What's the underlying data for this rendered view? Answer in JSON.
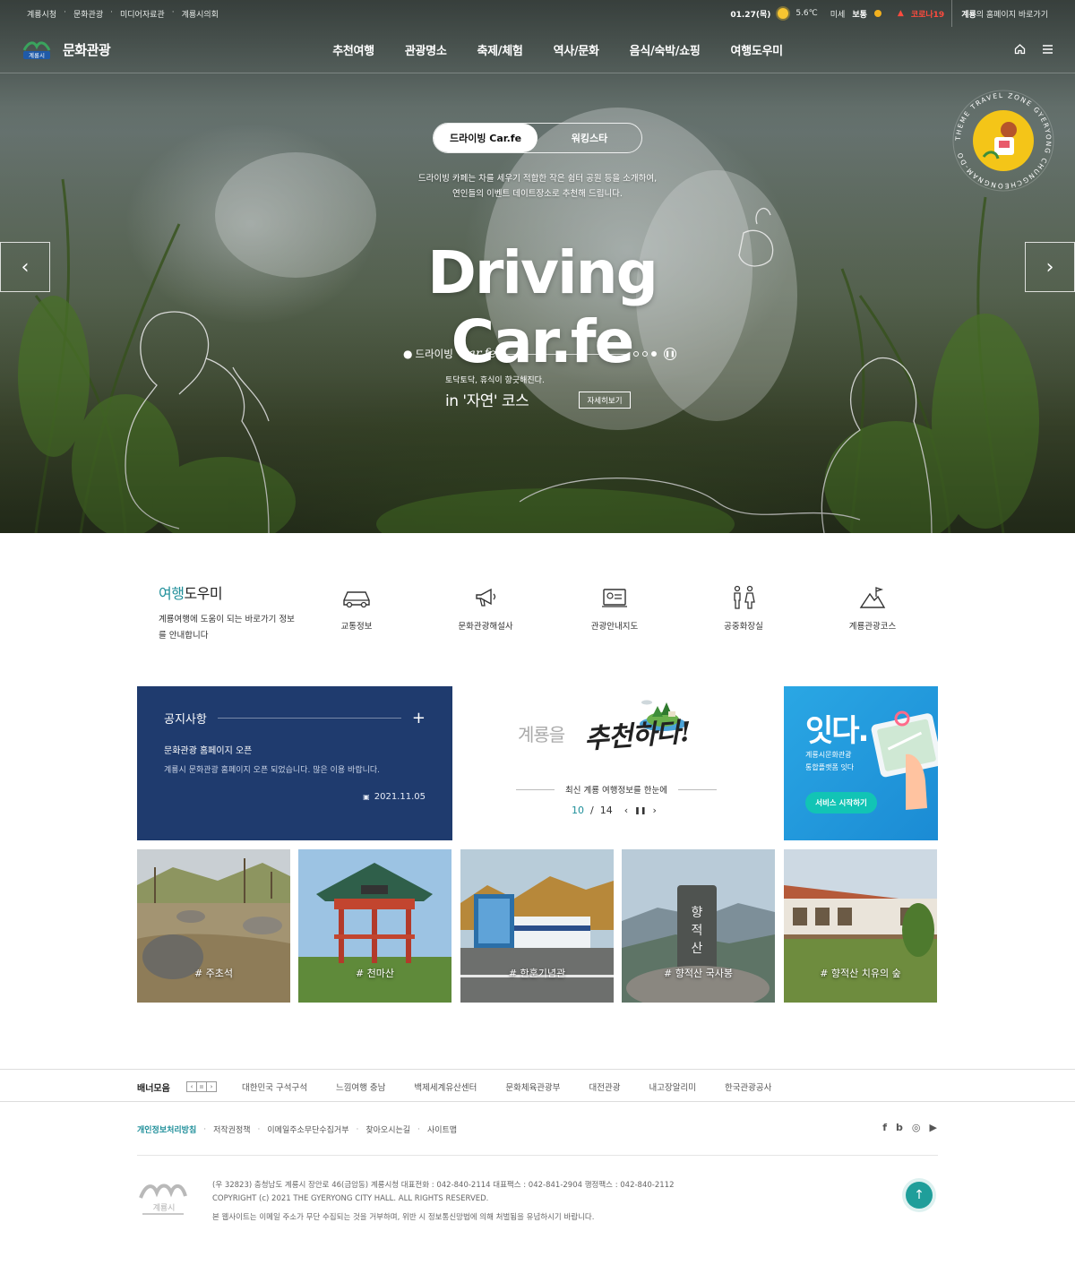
{
  "util": {
    "links": [
      "계룡시청",
      "문화관광",
      "미디어자료관",
      "계룡시의회"
    ],
    "date": "01.27(목)",
    "temp": "5.6℃",
    "dust_label": "미세",
    "dust_value": "보통",
    "corona": "코로나19",
    "shortcut_bold": "계룡",
    "shortcut_rest": "의 홈페이지 바로가기"
  },
  "gnb": {
    "logo_text": "계룡시",
    "title": "문화관광",
    "menu": [
      "추천여행",
      "관광명소",
      "축제/체험",
      "역사/문화",
      "음식/숙박/쇼핑",
      "여행도우미"
    ]
  },
  "hero": {
    "tab_active": "드라이빙 Car.fe",
    "tab_other": "워킹스타",
    "desc_line1": "드라이빙 카페는 차를 세우기 적합한 작은 쉼터 공원 등을 소개하여,",
    "desc_line2": "연인들의 이벤트 데이트장소로 추천해 드립니다.",
    "big_title": "Driving Car.fe",
    "course_label": "드라이빙",
    "course_script": "Car.fe",
    "course_sub": "토닥토닥, 휴식이 향긋해진다.",
    "course_title": "in '자연' 코스",
    "more": "자세히보기",
    "badge_text": "THEME TRAVEL ZONE GYERYONG CHUNGCHEONGNAM-DO",
    "slide_count": 3,
    "slide_active": 2
  },
  "quick": {
    "title_accent": "여행",
    "title_rest": "도우미",
    "desc": "계룡여행에 도움이 되는 바로가기 정보를 안내합니다",
    "items": [
      {
        "label": "교통정보",
        "icon": "car-icon"
      },
      {
        "label": "문화관광해설사",
        "icon": "megaphone-icon"
      },
      {
        "label": "관광안내지도",
        "icon": "map-icon"
      },
      {
        "label": "공중화장실",
        "icon": "restroom-icon"
      },
      {
        "label": "계룡관광코스",
        "icon": "mountain-flag-icon"
      }
    ]
  },
  "notice": {
    "title": "공지사항",
    "subject": "문화관광 홈페이지 오픈",
    "body": "계룡시 문화관광 홈페이지 오픈 되었습니다. 많은 이용 바랍니다.",
    "date": "2021.11.05"
  },
  "recommend": {
    "text1": "계룡을",
    "text2": "추천하다!",
    "caption": "최신 계룡 여행정보를 한눈에",
    "current": "10",
    "total": "14"
  },
  "itda": {
    "logo": "잇다.",
    "desc_line1": "계룡시문화관광",
    "desc_line2": "통합플랫폼 잇다",
    "button": "서비스 시작하기"
  },
  "gallery": [
    {
      "caption": "# 주초석"
    },
    {
      "caption": "# 천마산"
    },
    {
      "caption": "# 한훈기념관"
    },
    {
      "caption": "# 향적산 국사봉"
    },
    {
      "caption": "# 향적산 치유의 숲"
    }
  ],
  "banner": {
    "title": "배너모음",
    "links": [
      "대한민국 구석구석",
      "느낌여행 충남",
      "백제세계유산센터",
      "문화체육관광부",
      "대전관광",
      "내고장알리미",
      "한국관광공사"
    ]
  },
  "footer": {
    "links": [
      "개인정보처리방침",
      "저작권정책",
      "이메일주소무단수집거부",
      "찾아오시는길",
      "사이트맵"
    ],
    "sns": [
      "f",
      "b",
      "◎",
      "▶"
    ],
    "logo_text": "계룡시",
    "address": "(우 32823) 충청남도 계룡시 장안로 46(금암동)   계룡시청 대표전화 : 042-840-2114   대표팩스 : 042-841-2904   행정팩스 : 042-840-2112",
    "copyright": "COPYRIGHT (c) 2021 THE GYERYONG CITY HALL. ALL RIGHTS RESERVED.",
    "notice": "본 웹사이트는 이메일 주소가 무단 수집되는 것을 거부하며, 위반 시 정보통신망법에 의해 처벌됨을 유념하시기 바랍니다."
  },
  "colors": {
    "accent": "#1f8f9a",
    "notice_bg": "#1f3b6e",
    "itda_bg": "#1b8bd4",
    "itda_button": "#12c4b5",
    "corona": "#ff4b3e"
  }
}
